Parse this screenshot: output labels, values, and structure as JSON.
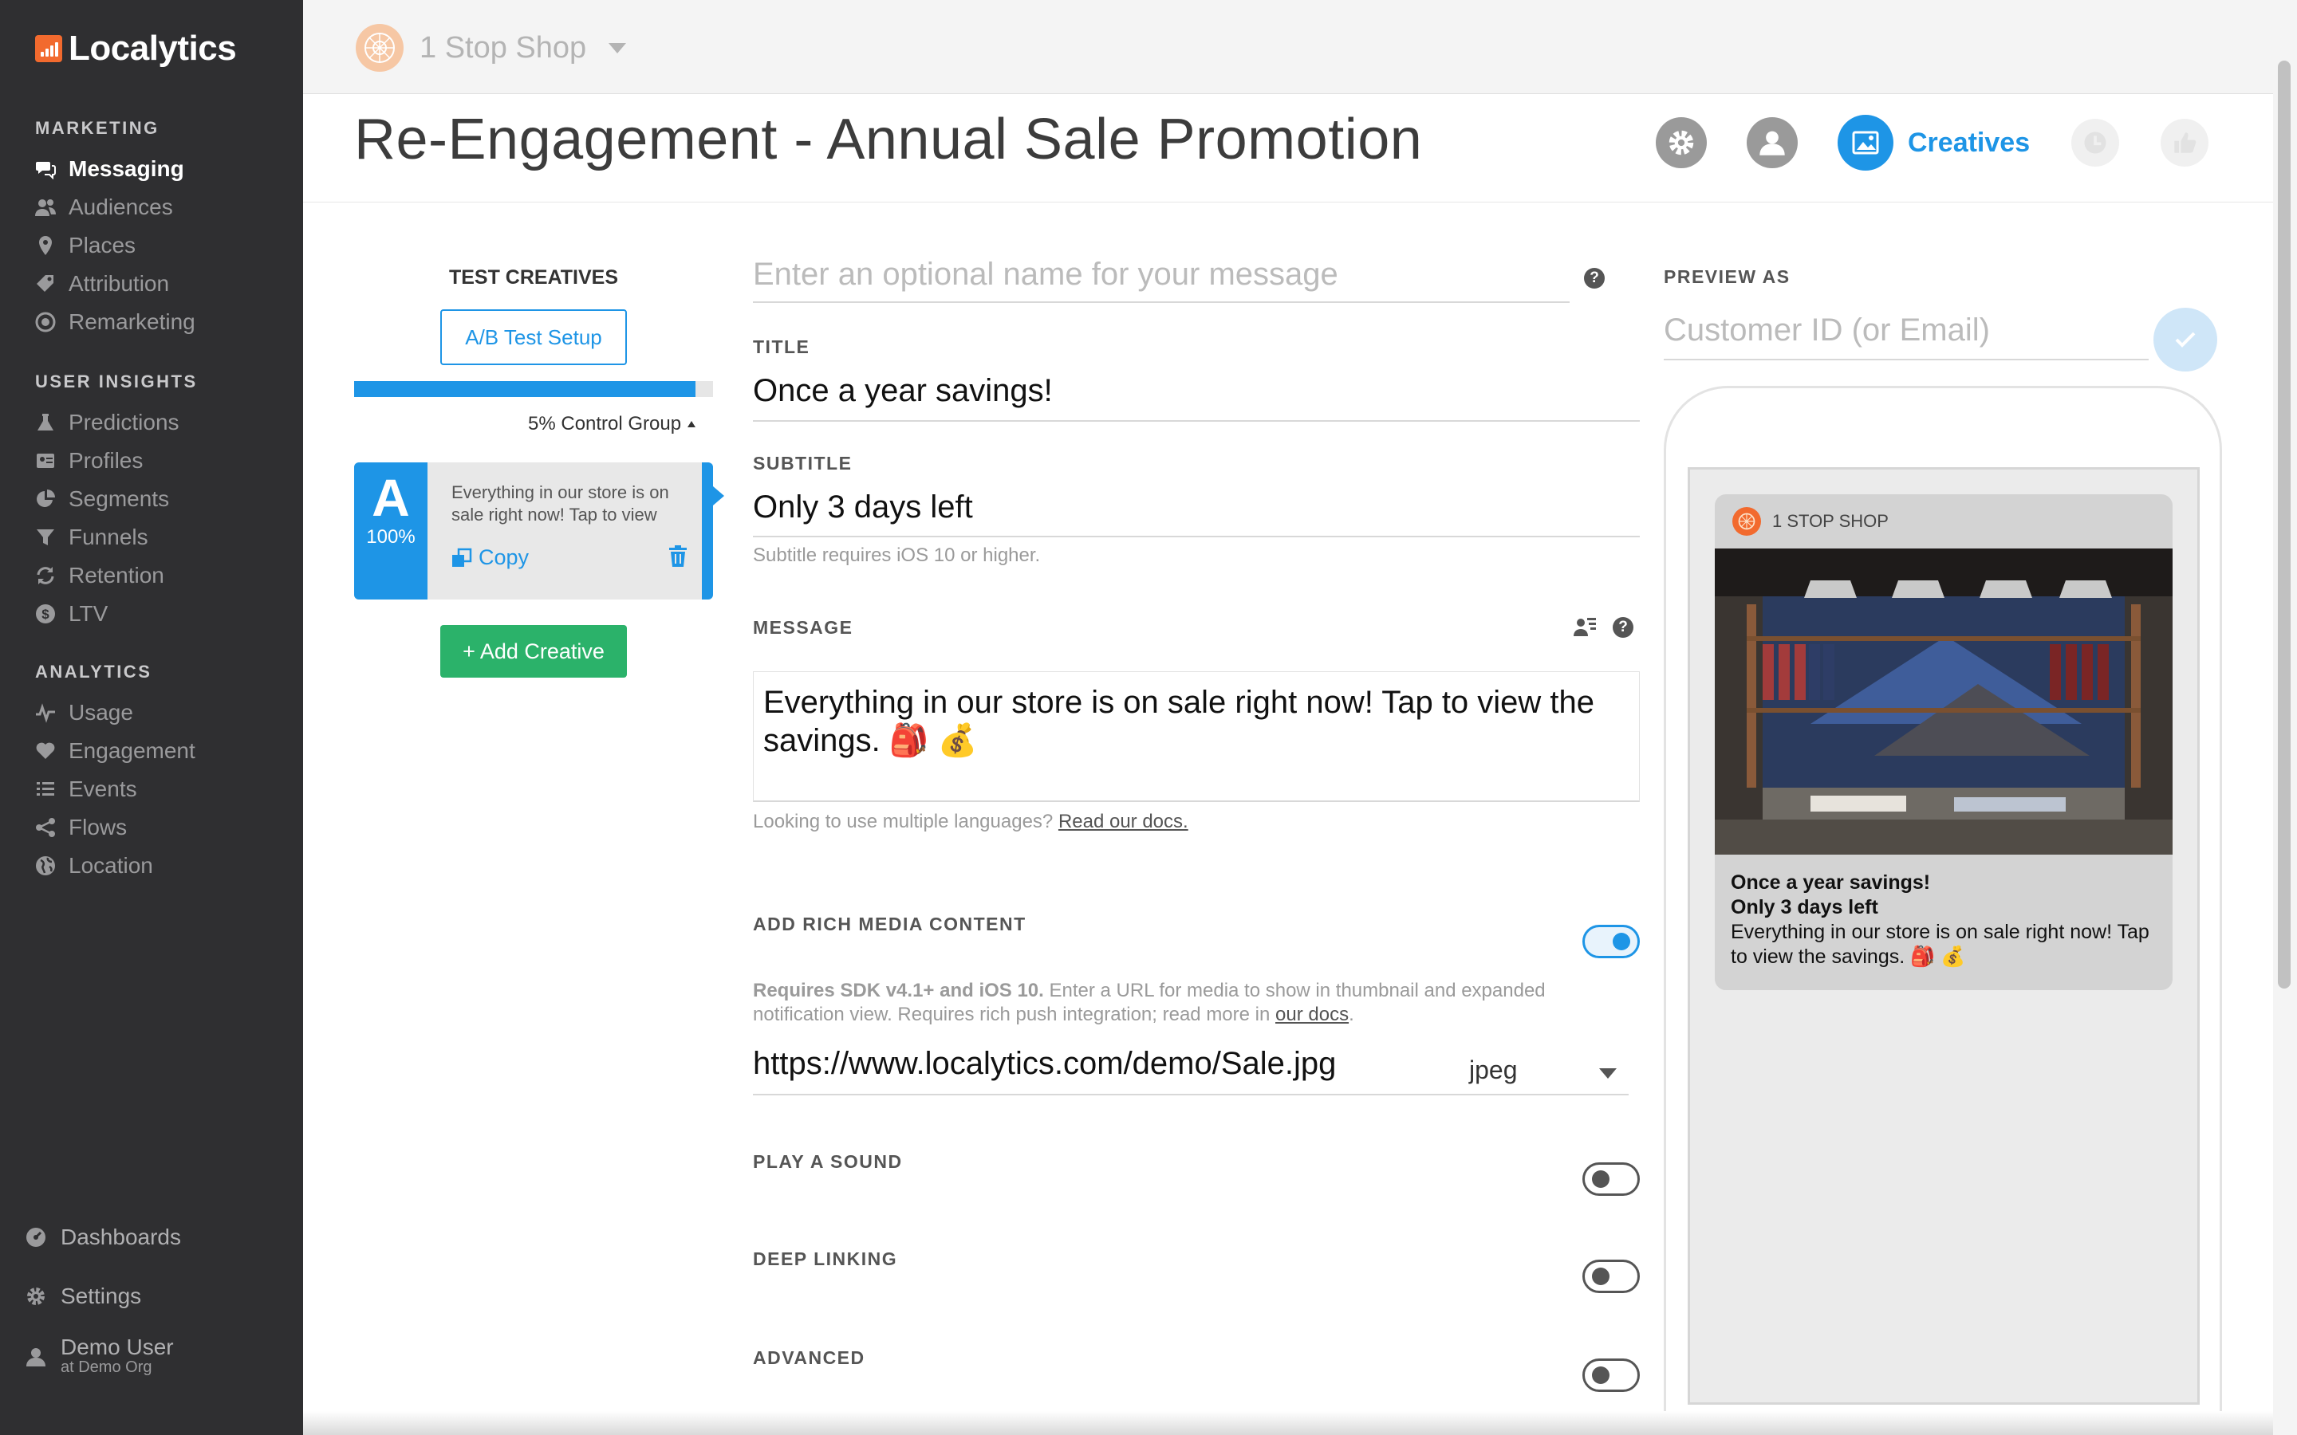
{
  "brand": {
    "name": "Localytics",
    "accent": "#1e95e6",
    "logo_orange": "#f26a2e",
    "green": "#2bb26a"
  },
  "sidebar": {
    "marketing_heading": "MARKETING",
    "marketing_items": [
      {
        "label": "Messaging",
        "icon": "chat-bubbles-icon",
        "active": true
      },
      {
        "label": "Audiences",
        "icon": "people-icon"
      },
      {
        "label": "Places",
        "icon": "map-pin-icon"
      },
      {
        "label": "Attribution",
        "icon": "tag-icon"
      },
      {
        "label": "Remarketing",
        "icon": "target-icon"
      }
    ],
    "insights_heading": "USER INSIGHTS",
    "insights_items": [
      {
        "label": "Predictions",
        "icon": "flask-icon"
      },
      {
        "label": "Profiles",
        "icon": "id-card-icon"
      },
      {
        "label": "Segments",
        "icon": "pie-icon"
      },
      {
        "label": "Funnels",
        "icon": "funnel-icon"
      },
      {
        "label": "Retention",
        "icon": "refresh-icon"
      },
      {
        "label": "LTV",
        "icon": "dollar-icon"
      }
    ],
    "analytics_heading": "ANALYTICS",
    "analytics_items": [
      {
        "label": "Usage",
        "icon": "pulse-icon"
      },
      {
        "label": "Engagement",
        "icon": "heart-icon"
      },
      {
        "label": "Events",
        "icon": "list-icon"
      },
      {
        "label": "Flows",
        "icon": "share-icon"
      },
      {
        "label": "Location",
        "icon": "globe-icon"
      }
    ],
    "bottom": {
      "dashboards": "Dashboards",
      "settings": "Settings",
      "user_name": "Demo User",
      "user_org": "at Demo Org"
    }
  },
  "topbar": {
    "app_name": "1 Stop Shop"
  },
  "header": {
    "title": "Re-Engagement - Annual Sale Promotion",
    "active_step_label": "Creatives",
    "steps": [
      "settings-step-icon",
      "audience-step-icon",
      "creatives-step-icon",
      "schedule-step-icon",
      "confirm-step-icon"
    ]
  },
  "creatives": {
    "title": "TEST CREATIVES",
    "ab_button": "A/B Test Setup",
    "control_group": "5% Control Group",
    "control_fraction": 0.05,
    "card": {
      "letter": "A",
      "percent": "100%",
      "snippet": "Everything in our store is on sale right now! Tap to view",
      "copy_label": "Copy"
    },
    "add_button": "+ Add Creative"
  },
  "form": {
    "name_placeholder": "Enter an optional name for your message",
    "title_label": "TITLE",
    "title_value": "Once a year savings!",
    "subtitle_label": "SUBTITLE",
    "subtitle_value": "Only 3 days left",
    "subtitle_hint": "Subtitle requires iOS 10 or higher.",
    "message_label": "MESSAGE",
    "message_value": "Everything in our store is on sale right now! Tap to view the savings. 🎒 💰",
    "languages_hint": "Looking to use multiple languages?",
    "languages_link": "Read our docs.",
    "rich_media_label": "ADD RICH MEDIA CONTENT",
    "rich_media_on": true,
    "rich_media_hint_bold": "Requires SDK v4.1+ and iOS 10.",
    "rich_media_hint": " Enter a URL for media to show in thumbnail and expanded notification view. Requires rich push integration; read more in ",
    "rich_media_link": "our docs",
    "rich_media_hint_end": ".",
    "media_url": "https://www.localytics.com/demo/Sale.jpg",
    "media_type": "jpeg",
    "sound_label": "PLAY A SOUND",
    "sound_on": false,
    "deeplink_label": "DEEP LINKING",
    "deeplink_on": false,
    "advanced_label": "ADVANCED",
    "advanced_on": false
  },
  "preview": {
    "label": "PREVIEW AS",
    "placeholder": "Customer ID (or Email)",
    "app_label": "1 STOP SHOP",
    "notif_title": "Once a year savings!",
    "notif_subtitle": "Only 3 days left",
    "notif_message": "Everything in our store is on sale right now! Tap to view the savings. 🎒 💰"
  }
}
